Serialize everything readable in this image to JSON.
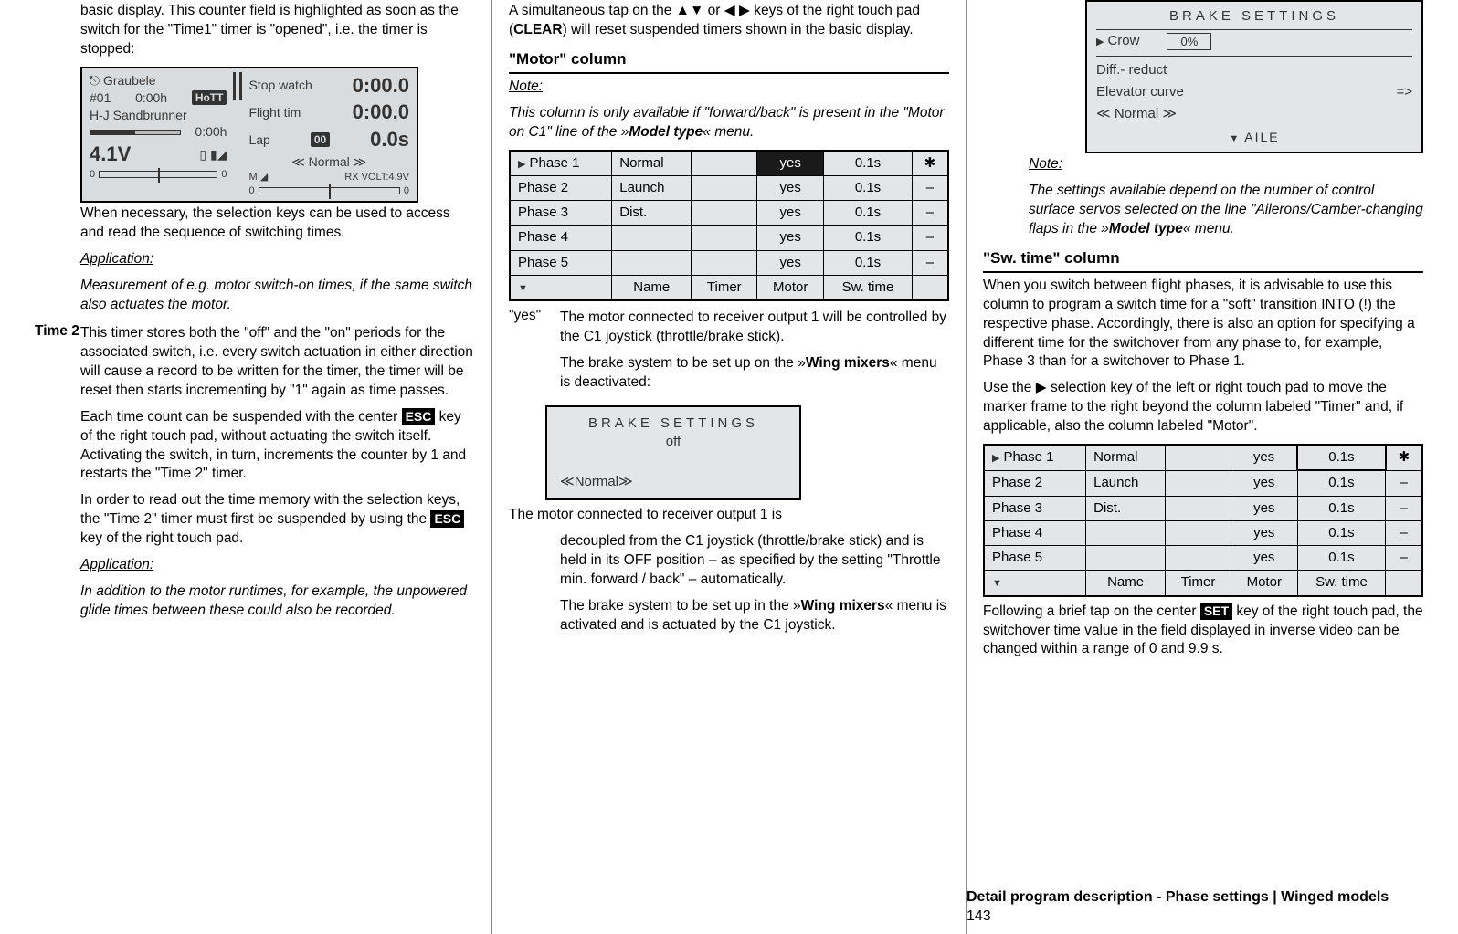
{
  "col1": {
    "p1": "basic display. This counter field is highlighted as soon as the switch for the \"Time1\" timer is \"opened\", i.e. the timer is stopped:",
    "lcd": {
      "name": "Graubele",
      "hash": "#01",
      "t0a": "0:00h",
      "hott": "HoTT",
      "pilot": "H-J Sandbrunner",
      "t0b": "0:00h",
      "volt": "4.1V",
      "stopwatch_l": "Stop watch",
      "stopwatch_v": "0:00.0",
      "flight_l": "Flight tim",
      "flight_v": "0:00.0",
      "lap_l": "Lap",
      "lap_n": "00",
      "lap_v": "0.0s",
      "normal": "≪ Normal  ≫",
      "rx": "RX VOLT:4.9V",
      "zero": "0",
      "m": "M"
    },
    "p2": "When necessary, the selection keys can be used to access and read the sequence of switching times.",
    "app1_h": "Application:",
    "app1_b": "Measurement of e.g. motor switch-on times, if the same switch also actuates the motor.",
    "time2label": "Time 2",
    "p3": "This timer stores both the \"off\" and the \"on\" periods for the associated switch, i.e. every switch actuation in either direction will cause a record to be written for the timer, the timer will be reset then starts incrementing by \"1\" again as time passes.",
    "p4a": "Each time count can be suspended with the center ",
    "p4k": "ESC",
    "p4b": " key of the right touch pad, without actuating the switch itself. Activating the switch, in turn, increments the counter by 1 and restarts the \"Time 2\" timer.",
    "p5a": "In order to read out the time memory with the selection keys, the \"Time 2\" timer must first be suspended by using the ",
    "p5k": "ESC",
    "p5b": " key of the right touch pad.",
    "app2_h": "Application:",
    "app2_b": "In addition to the motor runtimes, for example, the unpowered glide times between these could also be recorded."
  },
  "col2": {
    "p1a": "A simultaneous tap on the ▲▼ or ◀ ▶ keys of the right touch pad (",
    "p1b": "CLEAR",
    "p1c": ") will reset suspended timers shown in the basic display.",
    "motor_h": "\"Motor\" column",
    "note_h": "Note:",
    "note_b": "This column is only available if \"forward/back\" is present in the \"Motor on C1\" line of the »",
    "note_b2": "Model type",
    "note_b3": "« menu.",
    "table": {
      "rows": [
        {
          "ph": "Phase  1",
          "nm": "Normal",
          "mt": "yes",
          "sw": "0.1s",
          "end": "✱",
          "sel": true,
          "motorInv": true
        },
        {
          "ph": "Phase  2",
          "nm": "Launch",
          "mt": "yes",
          "sw": "0.1s",
          "end": "–"
        },
        {
          "ph": "Phase  3",
          "nm": "Dist.",
          "mt": "yes",
          "sw": "0.1s",
          "end": "–"
        },
        {
          "ph": "Phase  4",
          "nm": "",
          "mt": "yes",
          "sw": "0.1s",
          "end": "–"
        },
        {
          "ph": "Phase  5",
          "nm": "",
          "mt": "yes",
          "sw": "0.1s",
          "end": "–"
        }
      ],
      "headers": {
        "name": "Name",
        "timer": "Timer",
        "motor": "Motor",
        "sw": "Sw. time"
      }
    },
    "yes_term": "\"yes\"",
    "yes_b1": "The motor connected to receiver output 1 will be controlled by the C1 joystick (throttle/brake stick).",
    "yes_b2a": "The brake system to be set up on the »",
    "yes_b2b": "Wing mixers",
    "yes_b2c": "« menu is deactivated:",
    "brakebox": {
      "title": "BRAKE SETTINGS",
      "off": "off",
      "nav": "≪Normal≫"
    },
    "p_last_a": "The motor connected to receiver output 1 is",
    "p_last_b": "decoupled from the C1 joystick (throttle/brake stick) and is held in its OFF position – as specified by the setting \"Throttle min. forward / back\" – automatically.",
    "p_last_c1": "The brake system to be set up in the »",
    "p_last_c2": "Wing mixers",
    "p_last_c3": "« menu is activated and is actuated by the C1 joystick."
  },
  "col3": {
    "panel": {
      "title": "BRAKE SETTINGS",
      "row1": "Crow",
      "pct": "0%",
      "row2": "Diff.- reduct",
      "row3": "Elevator curve",
      "arrow": "=>",
      "nav": "≪ Normal  ≫",
      "aile": "AILE"
    },
    "note_h": "Note:",
    "note_b1": "The settings available depend on the number of control surface servos selected on the line \"Ailerons/Camber-changing flaps in the »",
    "note_b2": "Model type",
    "note_b3": "« menu.",
    "sw_h": "\"Sw. time\" column",
    "p1": "When you switch between flight phases, it is advisable to use this column to program a switch time for a \"soft\" transition INTO (!) the respective phase. Accordingly, there is also an option for specifying a different time for the switchover from any phase to, for example, Phase 3 than for a switchover to Phase 1.",
    "p2": "Use the ▶ selection key of the left or right touch pad to move the marker frame to the right beyond the column labeled \"Timer\" and, if applicable, also the column labeled \"Motor\".",
    "table": {
      "rows": [
        {
          "ph": "Phase  1",
          "nm": "Normal",
          "mt": "yes",
          "sw": "0.1s",
          "end": "✱",
          "sel": true,
          "swBox": true
        },
        {
          "ph": "Phase  2",
          "nm": "Launch",
          "mt": "yes",
          "sw": "0.1s",
          "end": "–"
        },
        {
          "ph": "Phase  3",
          "nm": "Dist.",
          "mt": "yes",
          "sw": "0.1s",
          "end": "–"
        },
        {
          "ph": "Phase  4",
          "nm": "",
          "mt": "yes",
          "sw": "0.1s",
          "end": "–"
        },
        {
          "ph": "Phase  5",
          "nm": "",
          "mt": "yes",
          "sw": "0.1s",
          "end": "–"
        }
      ],
      "headers": {
        "name": "Name",
        "timer": "Timer",
        "motor": "Motor",
        "sw": "Sw. time"
      }
    },
    "p3a": "Following a brief tap on the center ",
    "p3k": "SET",
    "p3b": " key of the right touch pad, the switchover time value in the field displayed in inverse video can be changed within a range of 0 and 9.9 s."
  },
  "footer": {
    "title": "Detail program description - Phase settings | Winged models",
    "page": "143"
  }
}
